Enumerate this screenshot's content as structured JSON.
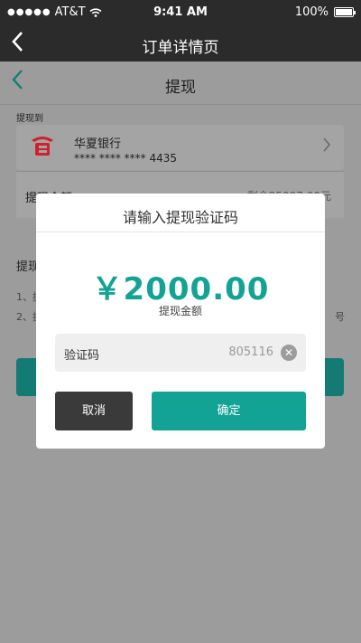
{
  "status_bar": {
    "carrier": "AT&T",
    "time": "9:41 AM",
    "battery": "100%"
  },
  "app_nav": {
    "title": "订单详情页"
  },
  "page": {
    "title": "提现",
    "withdraw_to_label": "提现到",
    "bank": {
      "name": "华夏银行",
      "card_number": "**** **** **** 4435"
    },
    "amount_label": "提现金额",
    "balance_text": "剩余25097.00元",
    "notes_title": "提现",
    "note1": "1、提",
    "note2": "2、提",
    "note_end": "号"
  },
  "modal": {
    "title": "请输入提现验证码",
    "amount": "￥2000.00",
    "amount_caption": "提现金额",
    "code_label": "验证码",
    "code_value": "805116",
    "cancel_label": "取消",
    "confirm_label": "确定"
  },
  "colors": {
    "accent": "#12a394",
    "dark": "#2b2b2b",
    "bank_red": "#d0202b"
  }
}
